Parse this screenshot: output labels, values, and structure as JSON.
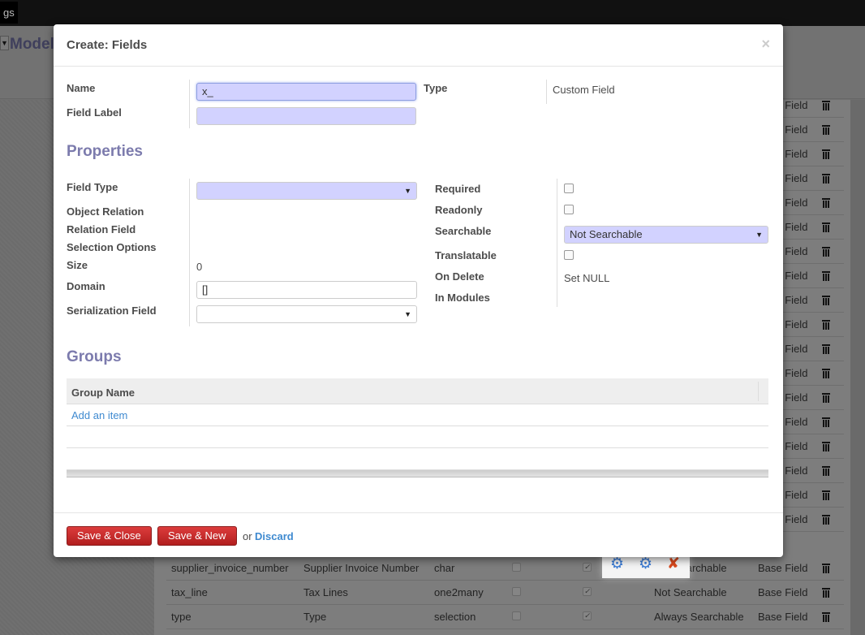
{
  "topbar": {
    "menu_label": "gs"
  },
  "background": {
    "title": "Models",
    "rows_right": [
      {
        "type": "Base Field"
      },
      {
        "type": "Base Field"
      },
      {
        "type": "Base Field"
      },
      {
        "type": "Base Field"
      },
      {
        "type": "Base Field"
      },
      {
        "type": "Base Field"
      },
      {
        "type": "Base Field"
      },
      {
        "type": "Base Field"
      },
      {
        "type": "Base Field"
      },
      {
        "type": "Base Field"
      },
      {
        "type": "Base Field"
      },
      {
        "type": "Base Field"
      },
      {
        "type": "Base Field"
      },
      {
        "type": "Base Field"
      },
      {
        "type": "Base Field"
      },
      {
        "type": "Base Field"
      },
      {
        "type": "Base Field"
      },
      {
        "type": "Base Field"
      }
    ],
    "rows_full": [
      {
        "name": "supplier_invoice_number",
        "label": "Supplier Invoice Number",
        "ftype": "char",
        "required": false,
        "readonly": true,
        "searchable": "Not Searchable",
        "kind": "Base Field"
      },
      {
        "name": "tax_line",
        "label": "Tax Lines",
        "ftype": "one2many",
        "required": false,
        "readonly": true,
        "searchable": "Not Searchable",
        "kind": "Base Field"
      },
      {
        "name": "type",
        "label": "Type",
        "ftype": "selection",
        "required": false,
        "readonly": true,
        "searchable": "Always Searchable",
        "kind": "Base Field"
      }
    ]
  },
  "modal": {
    "title": "Create: Fields",
    "close": "×",
    "name_label": "Name",
    "name_value": "x_",
    "field_label_label": "Field Label",
    "field_label_value": "",
    "type_label": "Type",
    "type_value": "Custom Field",
    "properties_heading": "Properties",
    "field_type_label": "Field Type",
    "field_type_value": "",
    "object_relation_label": "Object Relation",
    "relation_field_label": "Relation Field",
    "selection_options_label": "Selection Options",
    "size_label": "Size",
    "size_value": "0",
    "domain_label": "Domain",
    "domain_value": "[]",
    "serialization_label": "Serialization Field",
    "serialization_value": "",
    "required_label": "Required",
    "required": false,
    "readonly_label": "Readonly",
    "readonly": false,
    "searchable_label": "Searchable",
    "searchable_value": "Not Searchable",
    "translatable_label": "Translatable",
    "translatable": false,
    "on_delete_label": "On Delete",
    "on_delete_value": "Set NULL",
    "in_modules_label": "In Modules",
    "groups_heading": "Groups",
    "group_name_header": "Group Name",
    "add_item": "Add an item",
    "save_close": "Save & Close",
    "save_new": "Save & New",
    "or": "or",
    "discard": "Discard"
  },
  "colors": {
    "accent": "#7c7bad",
    "required_bg": "#d2d2ff",
    "button": "#c32b2b",
    "link": "#3f8ad0"
  }
}
